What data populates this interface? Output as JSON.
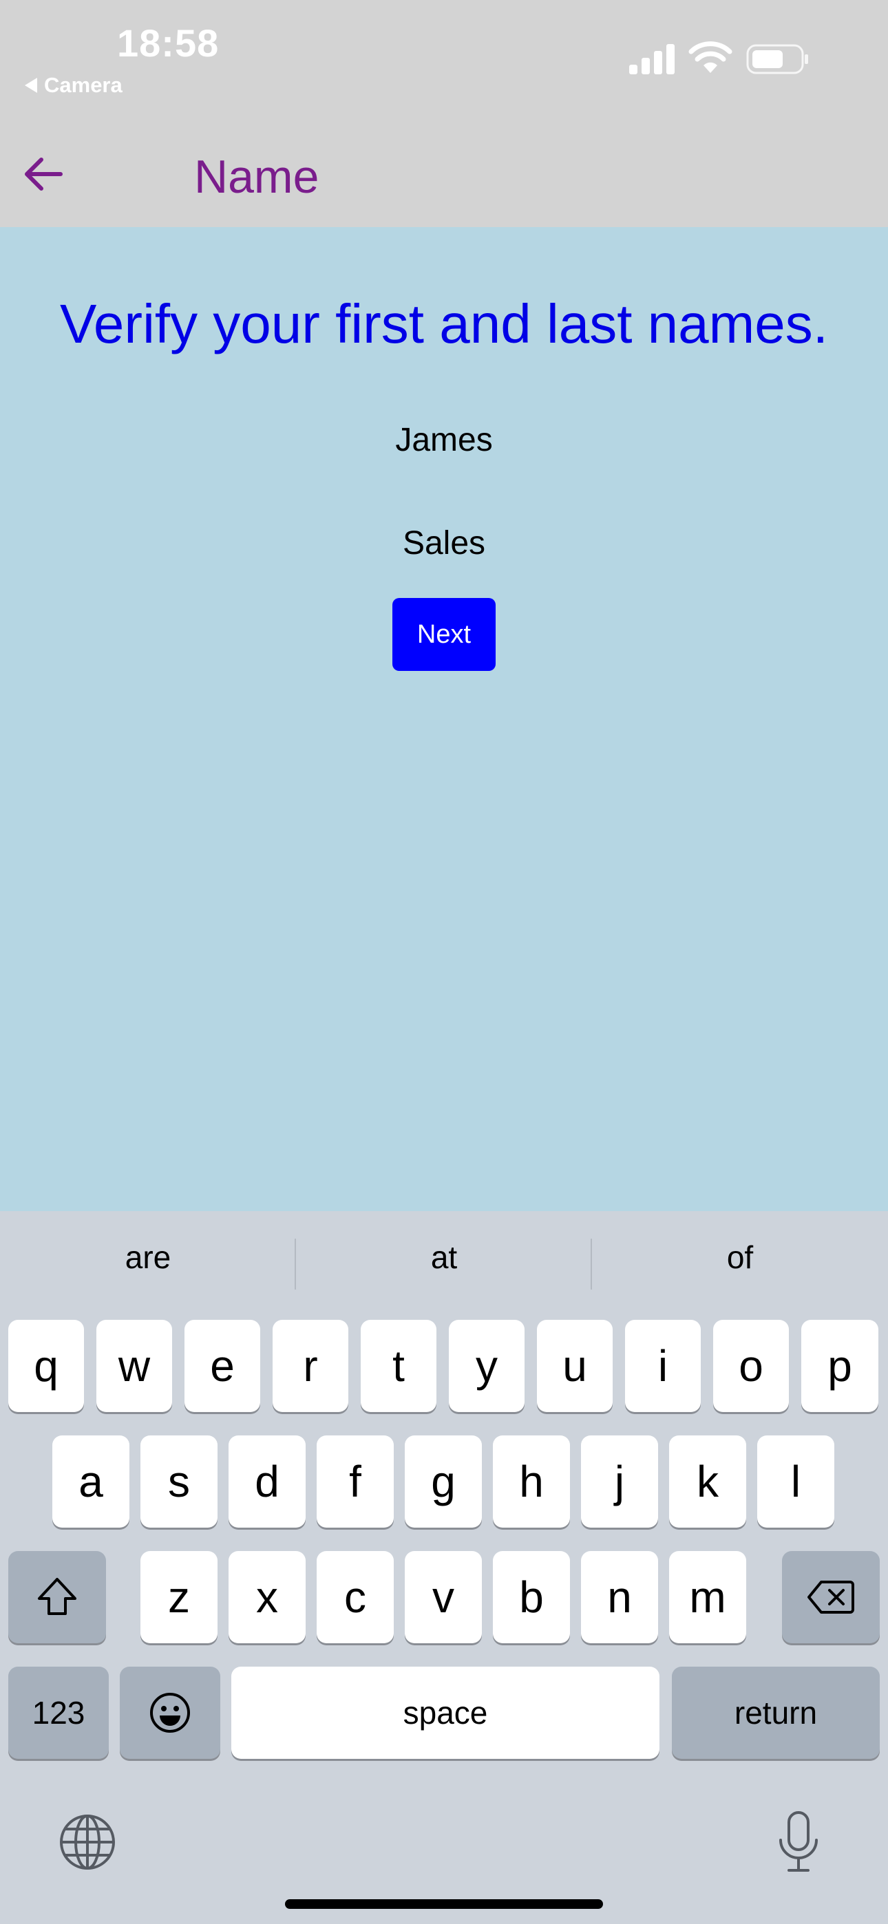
{
  "status_bar": {
    "time": "18:58",
    "back_app_label": "Camera"
  },
  "header": {
    "title": "Name"
  },
  "main": {
    "instruction": "Verify your first and last names.",
    "first_name": "James",
    "last_name": "Sales",
    "next_label": "Next"
  },
  "colors": {
    "title_purple": "#7a1d8c",
    "instruction_blue": "#0000e6",
    "button_blue": "#0000ff",
    "content_bg": "#b5d6e3",
    "header_bg": "#d3d3d3",
    "keyboard_bg": "#cdd3db"
  },
  "keyboard": {
    "suggestions": [
      "are",
      "at",
      "of"
    ],
    "row1": [
      "q",
      "w",
      "e",
      "r",
      "t",
      "y",
      "u",
      "i",
      "o",
      "p"
    ],
    "row2": [
      "a",
      "s",
      "d",
      "f",
      "g",
      "h",
      "j",
      "k",
      "l"
    ],
    "row3": [
      "z",
      "x",
      "c",
      "v",
      "b",
      "n",
      "m"
    ],
    "numbers_label": "123",
    "space_label": "space",
    "return_label": "return",
    "icons": [
      "shift-icon",
      "delete-icon",
      "emoji-icon",
      "globe-icon",
      "microphone-icon"
    ]
  }
}
